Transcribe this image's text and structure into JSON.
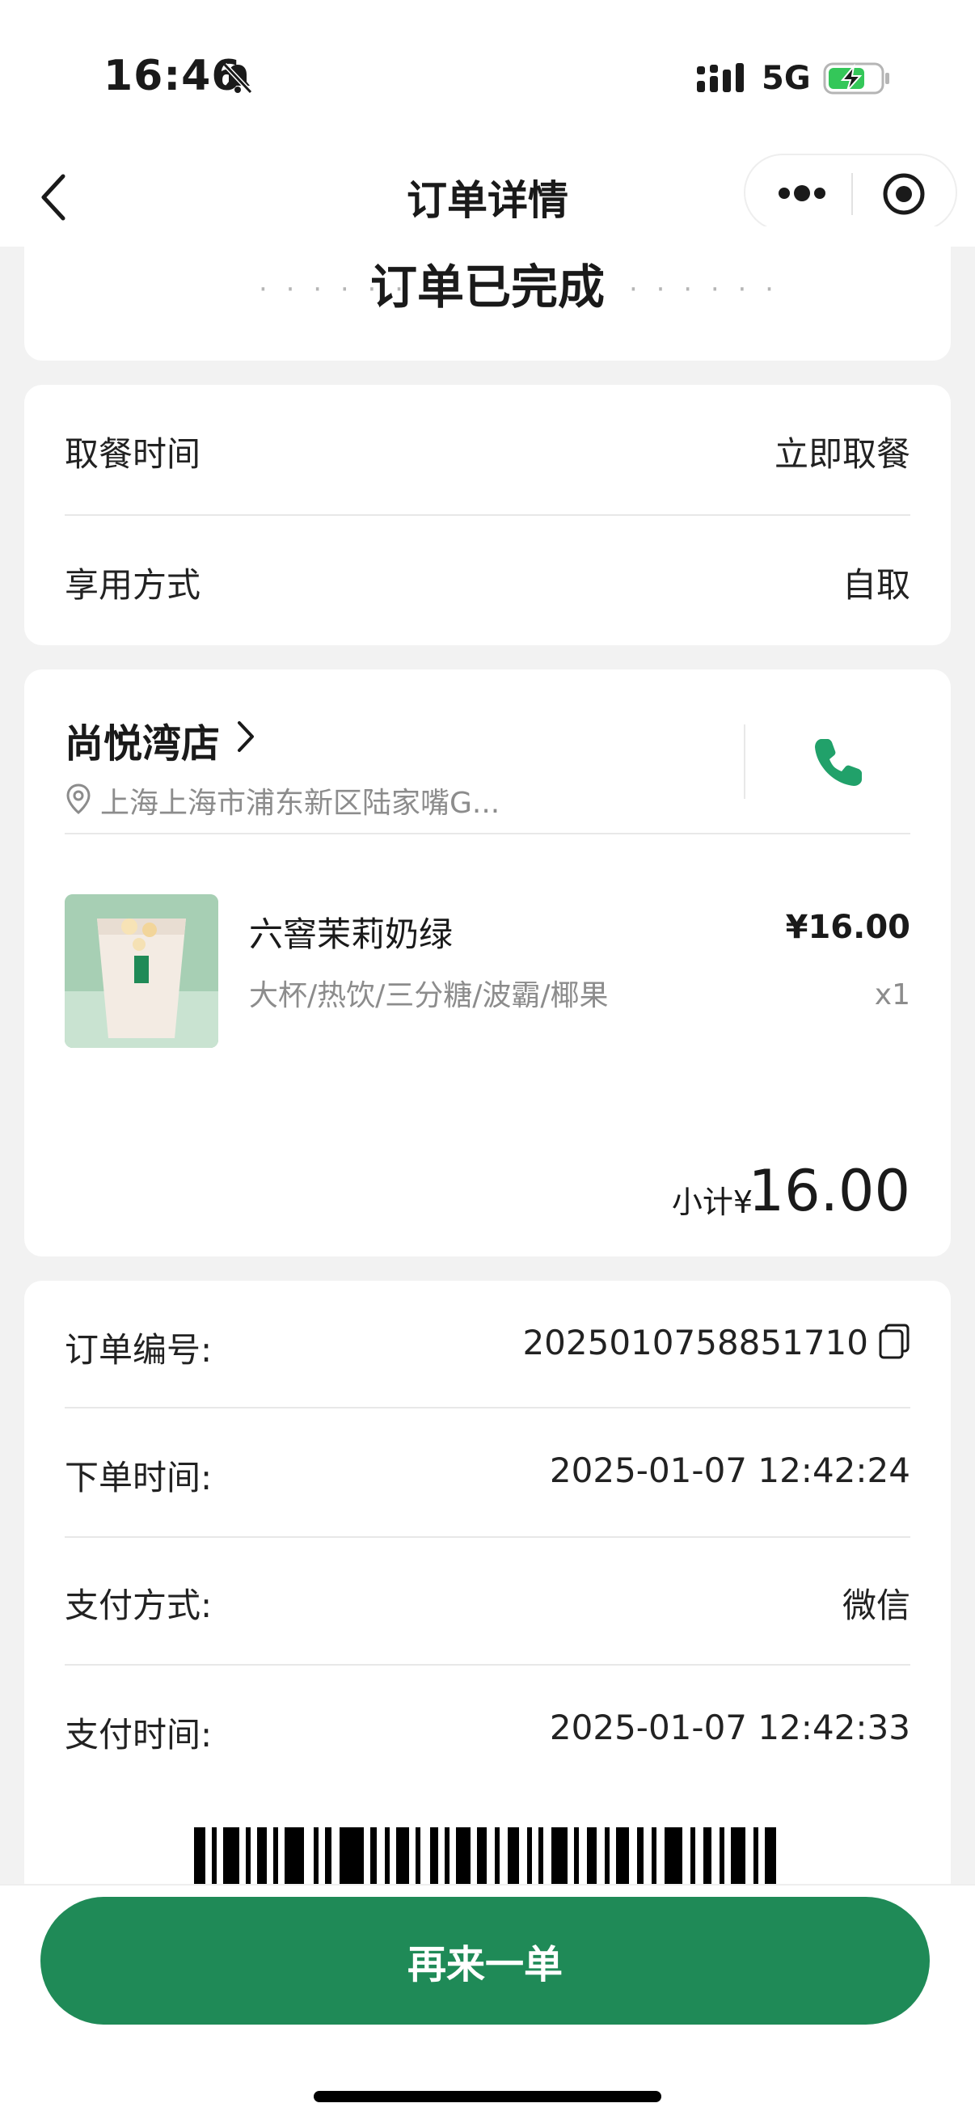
{
  "status_bar": {
    "time": "16:46",
    "network": "5G"
  },
  "nav": {
    "title": "订单详情"
  },
  "order_status": {
    "dots": "· · · · · ·",
    "text": "订单已完成"
  },
  "pickup": {
    "time_label": "取餐时间",
    "time_value": "立即取餐",
    "method_label": "享用方式",
    "method_value": "自取"
  },
  "store": {
    "name": "尚悦湾店",
    "address": "上海上海市浦东新区陆家嘴G..."
  },
  "product": {
    "name": "六窨茉莉奶绿",
    "spec": "大杯/热饮/三分糖/波霸/椰果",
    "price": "¥16.00",
    "qty": "x1"
  },
  "subtotal": {
    "label": "小计¥",
    "value": "16.00"
  },
  "details": {
    "order_no_label": "订单编号:",
    "order_no": "2025010758851710",
    "order_time_label": "下单时间:",
    "order_time": "2025-01-07 12:42:24",
    "pay_method_label": "支付方式:",
    "pay_method": "微信",
    "pay_time_label": "支付时间:",
    "pay_time": "2025-01-07 12:42:33"
  },
  "actions": {
    "reorder_label": "再来一单"
  },
  "colors": {
    "brand_green": "#1f8a57",
    "phone_green": "#21a16a"
  },
  "icons": [
    "bell-off-icon",
    "signal-icon",
    "battery-charging-icon",
    "back-icon",
    "more-icon",
    "target-icon",
    "chevron-right-icon",
    "location-pin-icon",
    "phone-icon",
    "copy-icon",
    "barcode"
  ]
}
